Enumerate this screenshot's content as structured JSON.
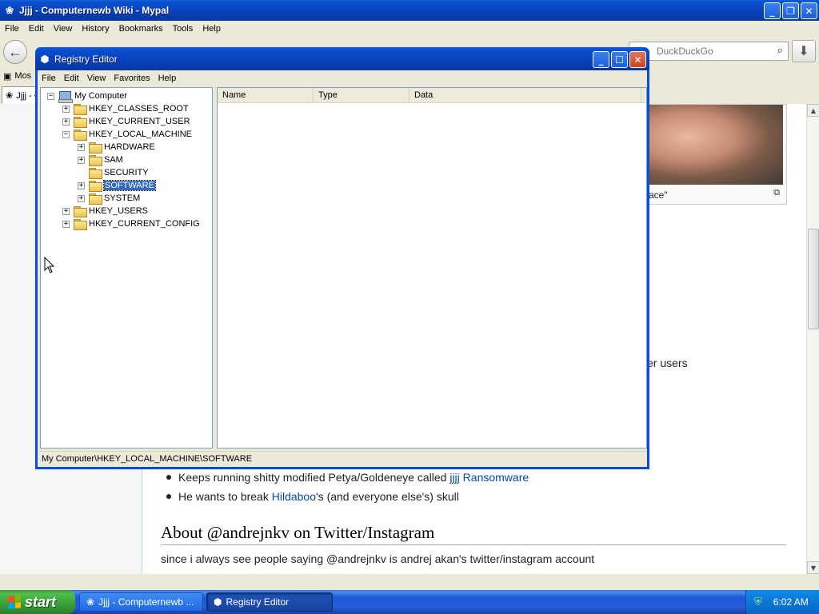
{
  "browser": {
    "title": "Jjjj - Computernewb Wiki - Mypal",
    "menu": [
      "File",
      "Edit",
      "View",
      "History",
      "Bookmarks",
      "Tools",
      "Help"
    ],
    "search_placeholder": "DuckDuckGo",
    "bookmark_label": "Mos",
    "tab_label": "Jjjj - C"
  },
  "page": {
    "photo_caption_fragment": "ace\"",
    "text_fragment": "er users",
    "bullet1_prefix": "Keeps running shitty modified Petya/Goldeneye called ",
    "bullet1_link1": "jjjj",
    "bullet1_link2": "Ransomware",
    "bullet2_prefix": "He wants to break ",
    "bullet2_link": "Hildaboo",
    "bullet2_suffix": "'s (and everyone else's) skull",
    "heading": "About @andrejnkv on Twitter/Instagram",
    "paragraph": "since i always see people saying @andrejnkv is andrej akan's twitter/instagram account"
  },
  "regedit": {
    "title": "Registry Editor",
    "menu": [
      "File",
      "Edit",
      "View",
      "Favorites",
      "Help"
    ],
    "columns": [
      "Name",
      "Type",
      "Data"
    ],
    "tree": {
      "root": "My Computer",
      "hives": [
        "HKEY_CLASSES_ROOT",
        "HKEY_CURRENT_USER",
        "HKEY_LOCAL_MACHINE",
        "HKEY_USERS",
        "HKEY_CURRENT_CONFIG"
      ],
      "hklm_children": [
        "HARDWARE",
        "SAM",
        "SECURITY",
        "SOFTWARE",
        "SYSTEM"
      ]
    },
    "status": "My Computer\\HKEY_LOCAL_MACHINE\\SOFTWARE"
  },
  "taskbar": {
    "start_label": "start",
    "tasks": [
      "Jjjj - Computernewb ...",
      "Registry Editor"
    ],
    "clock": "6:02 AM"
  },
  "colors": {
    "xp_title_blue": "#0840b8",
    "selection_blue": "#316ac5",
    "link_blue": "#0645ad",
    "start_green": "#379f37"
  }
}
